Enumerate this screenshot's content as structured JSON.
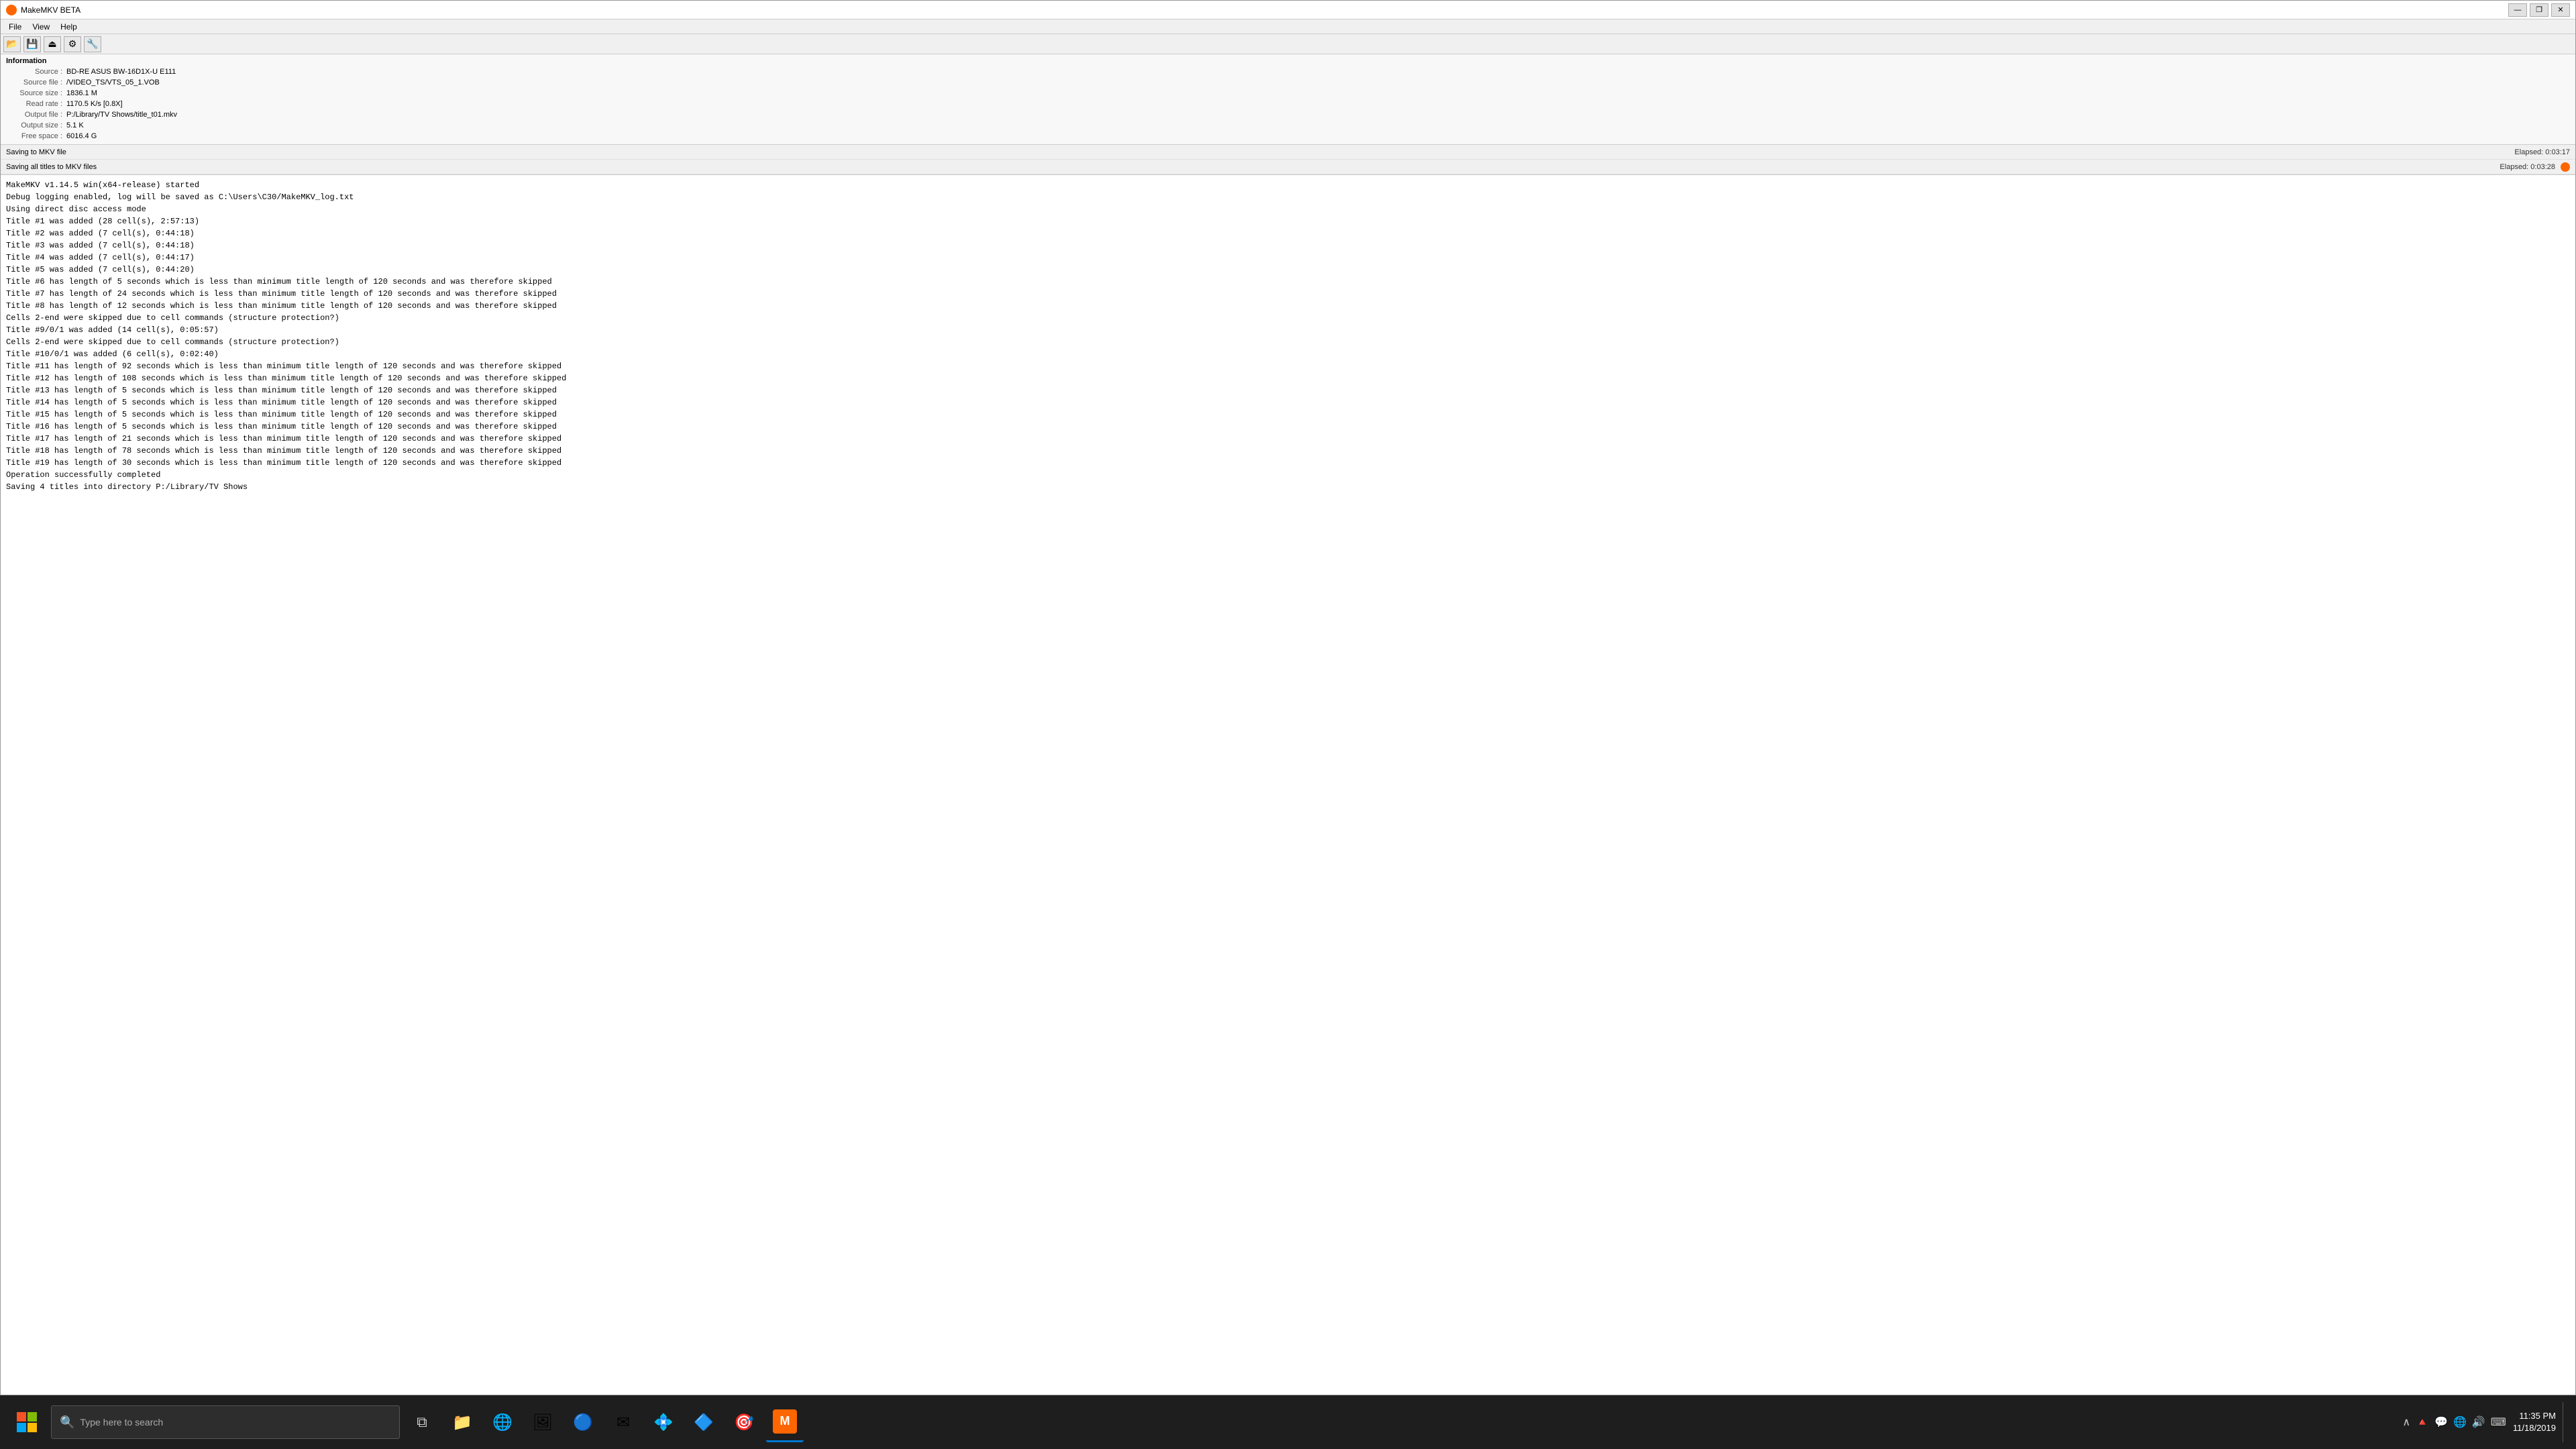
{
  "window": {
    "title": "MakeMKV BETA",
    "titleBarButtons": {
      "minimize": "—",
      "restore": "❐",
      "close": "✕"
    }
  },
  "menu": {
    "items": [
      "File",
      "View",
      "Help"
    ]
  },
  "toolbar": {
    "buttons": [
      "📂",
      "💾",
      "⏏",
      "⚙",
      "🔧"
    ]
  },
  "info": {
    "title": "Information",
    "rows": [
      {
        "label": "Source :",
        "value": "BD-RE ASUS BW-16D1X-U E111"
      },
      {
        "label": "Source file :",
        "value": "/VIDEO_TS/VTS_05_1.VOB"
      },
      {
        "label": "Source size :",
        "value": "1836.1 M"
      },
      {
        "label": "Read rate :",
        "value": "1170.5 K/s [0.8X]"
      },
      {
        "label": "Output file :",
        "value": "P:/Library/TV Shows/title_t01.mkv"
      },
      {
        "label": "Output size :",
        "value": "5.1 K"
      },
      {
        "label": "Free space :",
        "value": "6016.4 G"
      }
    ]
  },
  "progress": {
    "rows": [
      {
        "label": "Saving to MKV file",
        "elapsed": "Elapsed: 0:03:17",
        "showBar": false,
        "showIndicator": false
      },
      {
        "label": "Saving all titles to MKV files",
        "elapsed": "Elapsed: 0:03:28",
        "showBar": false,
        "showIndicator": true
      }
    ]
  },
  "log": {
    "lines": [
      "MakeMKV v1.14.5 win(x64-release) started",
      "Debug logging enabled, log will be saved as C:\\Users\\C30/MakeMKV_log.txt",
      "Using direct disc access mode",
      "Title #1 was added (28 cell(s), 2:57:13)",
      "Title #2 was added (7 cell(s), 0:44:18)",
      "Title #3 was added (7 cell(s), 0:44:18)",
      "Title #4 was added (7 cell(s), 0:44:17)",
      "Title #5 was added (7 cell(s), 0:44:20)",
      "Title #6 has length of 5 seconds which is less than minimum title length of 120 seconds and was therefore skipped",
      "Title #7 has length of 24 seconds which is less than minimum title length of 120 seconds and was therefore skipped",
      "Title #8 has length of 12 seconds which is less than minimum title length of 120 seconds and was therefore skipped",
      "Cells 2-end were skipped due to cell commands (structure protection?)",
      "Title #9/0/1 was added (14 cell(s), 0:05:57)",
      "Cells 2-end were skipped due to cell commands (structure protection?)",
      "Title #10/0/1 was added (6 cell(s), 0:02:40)",
      "Title #11 has length of 92 seconds which is less than minimum title length of 120 seconds and was therefore skipped",
      "Title #12 has length of 108 seconds which is less than minimum title length of 120 seconds and was therefore skipped",
      "Title #13 has length of 5 seconds which is less than minimum title length of 120 seconds and was therefore skipped",
      "Title #14 has length of 5 seconds which is less than minimum title length of 120 seconds and was therefore skipped",
      "Title #15 has length of 5 seconds which is less than minimum title length of 120 seconds and was therefore skipped",
      "Title #16 has length of 5 seconds which is less than minimum title length of 120 seconds and was therefore skipped",
      "Title #17 has length of 21 seconds which is less than minimum title length of 120 seconds and was therefore skipped",
      "Title #18 has length of 78 seconds which is less than minimum title length of 120 seconds and was therefore skipped",
      "Title #19 has length of 30 seconds which is less than minimum title length of 120 seconds and was therefore skipped",
      "Operation successfully completed",
      "Saving 4 titles into directory P:/Library/TV Shows"
    ]
  },
  "taskbar": {
    "searchPlaceholder": "Type here to search",
    "clock": {
      "time": "11:35 PM",
      "date": "11/18/2019"
    },
    "apps": [
      {
        "name": "makemkv",
        "label": "M",
        "color": "#ff6600"
      }
    ],
    "trayIcons": [
      "🔺",
      "💬",
      "🌐",
      "🔊",
      "⌨"
    ]
  }
}
